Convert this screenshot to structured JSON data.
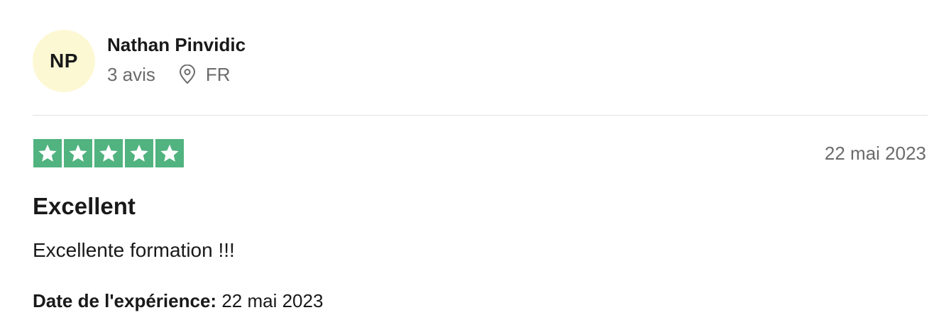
{
  "reviewer": {
    "initials": "NP",
    "name": "Nathan Pinvidic",
    "review_count": "3 avis",
    "country": "FR",
    "avatar_color": "#fdf8d4"
  },
  "review": {
    "rating": 5,
    "rating_max": 5,
    "star_color": "#51b37f",
    "date": "22 mai 2023",
    "title": "Excellent",
    "text": "Excellente formation !!!",
    "experience_label": "Date de l'expérience:",
    "experience_date": "22 mai 2023"
  },
  "icons": {
    "location": "location-pin-icon",
    "star": "star-icon"
  }
}
